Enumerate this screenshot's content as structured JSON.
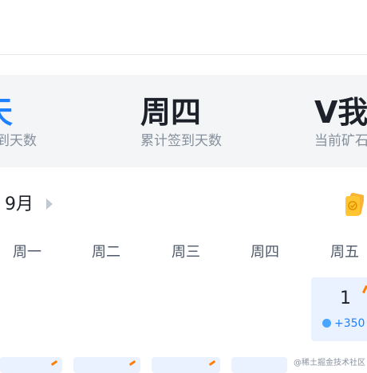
{
  "stats": [
    {
      "big": "天",
      "small": "签到天数"
    },
    {
      "big": "周四",
      "small": "累计签到天数"
    },
    {
      "big": "V我",
      "small": "当前矿石"
    }
  ],
  "calendar": {
    "month": "9月",
    "weekdays": [
      "周一",
      "周二",
      "周三",
      "周四",
      "周五"
    ],
    "today": {
      "day": "1",
      "reward": "+350"
    }
  },
  "watermark": "@稀土掘金技术社区",
  "colors": {
    "accent": "#1e80ff",
    "reward_bg": "#eaf2ff"
  },
  "icons": {
    "card": "card-gift-icon",
    "next": "chevron-right-icon",
    "gem": "gem-icon"
  }
}
